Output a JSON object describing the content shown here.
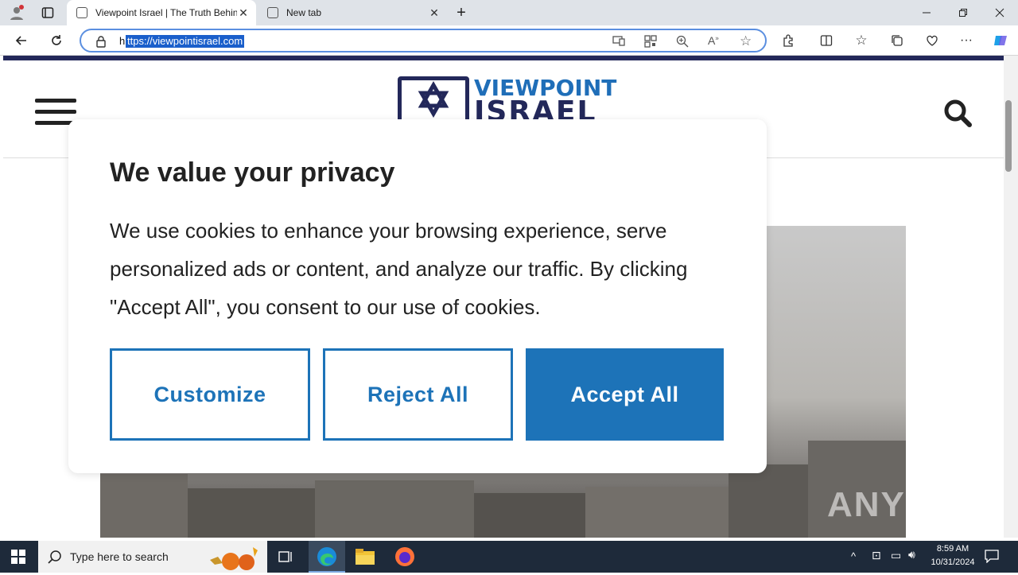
{
  "browser": {
    "tabs": [
      {
        "title": "Viewpoint Israel | The Truth Behind"
      },
      {
        "title": "New tab"
      }
    ],
    "url_scheme_char": "h",
    "url_selected": "ttps://viewpointisrael.com"
  },
  "site": {
    "logo_line1": "VIEWPOINT",
    "logo_line2": "ISRAEL"
  },
  "cookie_modal": {
    "heading": "We value your privacy",
    "body": "We use cookies to enhance your browsing experience, serve personalized ads or content, and analyze our traffic. By clicking \"Accept All\", you consent to our use of cookies.",
    "customize_label": "Customize",
    "reject_label": "Reject All",
    "accept_label": "Accept All",
    "accent_color": "#1d73b8"
  },
  "taskbar": {
    "search_placeholder": "Type here to search",
    "time": "8:59 AM",
    "date": "10/31/2024"
  },
  "watermark": "ANY RUN"
}
